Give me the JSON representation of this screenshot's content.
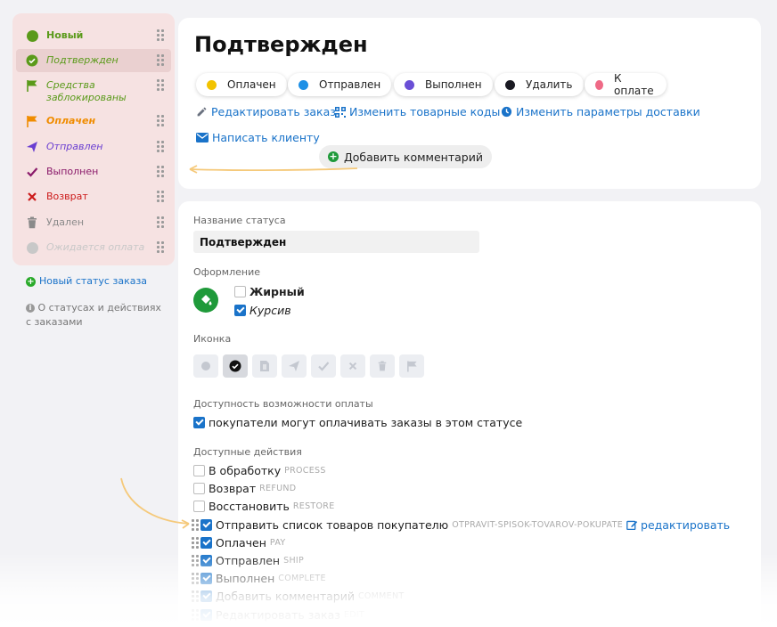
{
  "sidebar": {
    "items": [
      {
        "label": "Новый",
        "color": "#5a9a1a",
        "italic": false,
        "bold": true
      },
      {
        "label": "Подтвержден",
        "color": "#5a9a1a",
        "italic": true,
        "bold": false
      },
      {
        "label": "Средства заблокированы",
        "color": "#5a9a1a",
        "italic": true,
        "bold": false
      },
      {
        "label": "Оплачен",
        "color": "#f08c00",
        "italic": true,
        "bold": true
      },
      {
        "label": "Отправлен",
        "color": "#6a3fd1",
        "italic": true,
        "bold": false
      },
      {
        "label": "Выполнен",
        "color": "#8a1a6a",
        "italic": false,
        "bold": false
      },
      {
        "label": "Возврат",
        "color": "#cc1a1a",
        "italic": false,
        "bold": false
      },
      {
        "label": "Удален",
        "color": "#8a8a8a",
        "italic": false,
        "bold": false
      },
      {
        "label": "Ожидается оплата",
        "color": "#c8c8c8",
        "italic": true,
        "bold": false
      }
    ],
    "new_status_link": "Новый статус заказа",
    "info_link": "О статусах и действиях с заказами"
  },
  "header": {
    "title": "Подтвержден",
    "chips": [
      {
        "label": "Оплачен",
        "color": "#f2c300"
      },
      {
        "label": "Отправлен",
        "color": "#1e90e6"
      },
      {
        "label": "Выполнен",
        "color": "#6a4fd6"
      },
      {
        "label": "Удалить",
        "color": "#1a1a22"
      },
      {
        "label": "К оплате",
        "color": "#ef6a86"
      }
    ],
    "links": {
      "edit_order": "Редактировать заказ",
      "change_codes": "Изменить товарные коды",
      "change_delivery": "Изменить параметры доставки",
      "write_client": "Написать клиенту",
      "add_comment": "Добавить комментарий"
    }
  },
  "form": {
    "status_name_label": "Название статуса",
    "status_name_value": "Подтвержден",
    "design_label": "Оформление",
    "bold_label": "Жирный",
    "bold_checked": false,
    "italic_label": "Курсив",
    "italic_checked": true,
    "icon_label": "Иконка",
    "icons": [
      "circle-icon",
      "check-circle-icon",
      "document-icon",
      "send-icon",
      "check-icon",
      "cross-icon",
      "trash-icon",
      "flag-icon"
    ],
    "selected_icon": "check-circle-icon",
    "payment_label": "Доступность возможности оплаты",
    "payment_option": "покупатели могут оплачивать заказы в этом статусе",
    "payment_checked": true,
    "actions_label": "Доступные действия",
    "actions": [
      {
        "label": "В обработку",
        "code": "PROCESS",
        "checked": false
      },
      {
        "label": "Возврат",
        "code": "REFUND",
        "checked": false
      },
      {
        "label": "Восстановить",
        "code": "RESTORE",
        "checked": false
      },
      {
        "label": "Отправить список товаров покупателю",
        "code": "OTPRAVIT-SPISOK-TOVAROV-POKUPATE",
        "checked": true,
        "edit_link": "редактировать"
      },
      {
        "label": "Оплачен",
        "code": "PAY",
        "checked": true
      },
      {
        "label": "Отправлен",
        "code": "SHIP",
        "checked": true
      },
      {
        "label": "Выполнен",
        "code": "COMPLETE",
        "checked": true
      },
      {
        "label": "Добавить комментарий",
        "code": "COMMENT",
        "checked": true
      },
      {
        "label": "Редактировать заказ",
        "code": "EDIT",
        "checked": true
      }
    ]
  },
  "colors": {
    "accent": "#1a73c9",
    "sidebar_bg": "#f6e2e2",
    "arrow": "#f5c97a",
    "paint_button": "#1f9a3a"
  }
}
